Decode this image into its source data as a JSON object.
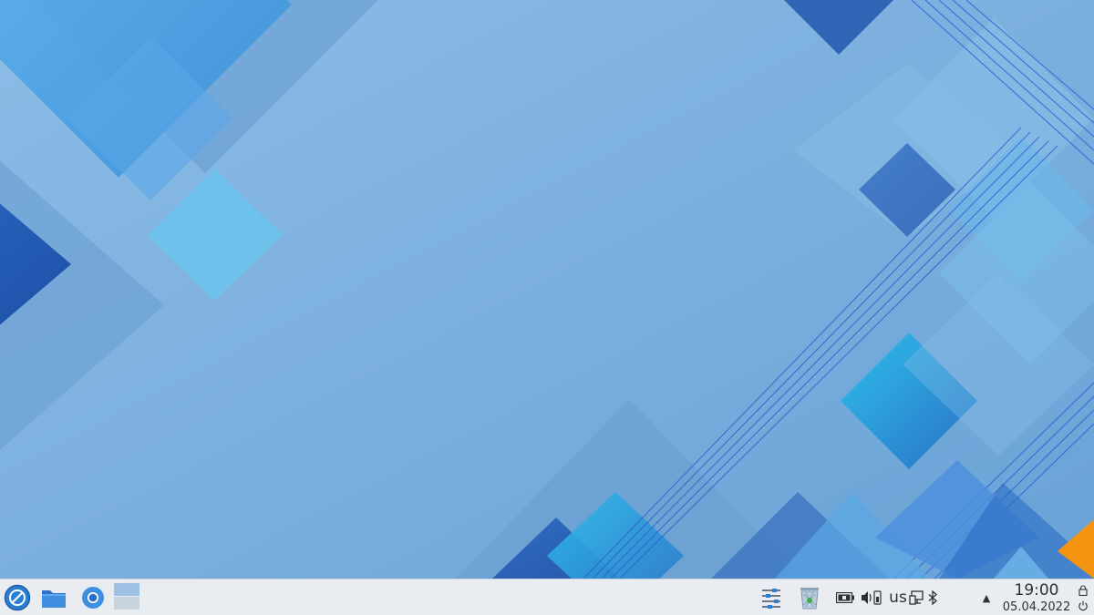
{
  "taskbar": {
    "launcher": {
      "icon": "application-launcher-icon"
    },
    "pinned": [
      {
        "name": "file-manager",
        "icon": "folder-icon"
      },
      {
        "name": "web-browser",
        "icon": "chromium-icon"
      }
    ],
    "pager": {
      "desktops": 2,
      "active": 1
    },
    "tray": {
      "icons": [
        "mixer-icon",
        "trash-icon",
        "battery-icon",
        "volume-icon",
        "network-icon",
        "bluetooth-icon"
      ],
      "keyboard_layout": "us",
      "expander": "▲"
    },
    "clock": {
      "time": "19:00",
      "date": "05.04.2022"
    },
    "session": {
      "icons": [
        "lock-icon",
        "power-icon"
      ]
    }
  },
  "colors": {
    "wallpaper_base": "#7cb0de",
    "taskbar_bg": "#e9edf2",
    "accent_blue": "#2a7fd4",
    "accent_orange": "#f5940e"
  }
}
